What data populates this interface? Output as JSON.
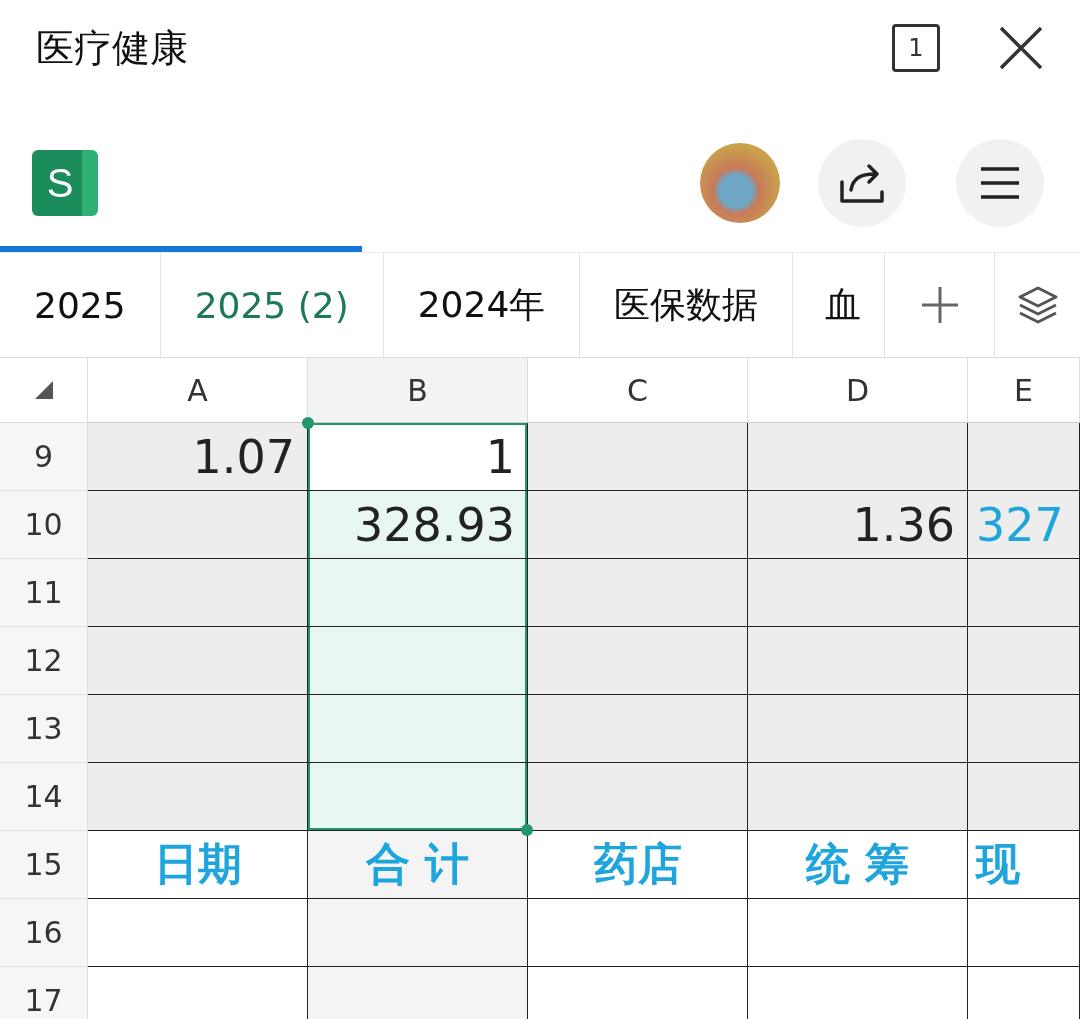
{
  "window": {
    "title": "医疗健康",
    "tab_count": "1"
  },
  "app": {
    "logo_letter": "S"
  },
  "loading_bar": {
    "level": 0.335
  },
  "sheet_tabs": [
    {
      "label": "2025",
      "selected": false
    },
    {
      "label": "2025 (2)",
      "selected": true
    },
    {
      "label": "2024年",
      "selected": false
    },
    {
      "label": "医保数据",
      "selected": false
    },
    {
      "label": "血",
      "selected": false
    }
  ],
  "grid": {
    "columns": [
      {
        "label": "A",
        "selected": false
      },
      {
        "label": "B",
        "selected": true
      },
      {
        "label": "C",
        "selected": false
      },
      {
        "label": "D",
        "selected": false
      },
      {
        "label": "E",
        "selected": false
      }
    ],
    "rows": [
      {
        "number": "9",
        "shaded": true,
        "cells": [
          {
            "text": "1.07",
            "selected": false,
            "active": false
          },
          {
            "text": "1",
            "selected": true,
            "active": true
          },
          {
            "selected": false,
            "active": false
          },
          {
            "selected": false,
            "active": false
          },
          {
            "selected": false,
            "active": false
          }
        ]
      },
      {
        "number": "10",
        "shaded": true,
        "cells": [
          {
            "selected": false,
            "active": false
          },
          {
            "text": "328.93",
            "selected": true,
            "active": false
          },
          {
            "selected": false,
            "active": false
          },
          {
            "text": "1.36",
            "selected": false,
            "active": false
          },
          {
            "text": "327",
            "color": "#1ea5dd",
            "selected": false,
            "active": false
          }
        ]
      },
      {
        "number": "11",
        "shaded": true,
        "cells": [
          {
            "selected": false,
            "active": false
          },
          {
            "selected": true,
            "active": false
          },
          {
            "selected": false,
            "active": false
          },
          {
            "selected": false,
            "active": false
          },
          {
            "selected": false,
            "active": false
          }
        ]
      },
      {
        "number": "12",
        "shaded": true,
        "cells": [
          {
            "selected": false,
            "active": false
          },
          {
            "selected": true,
            "active": false
          },
          {
            "selected": false,
            "active": false
          },
          {
            "selected": false,
            "active": false
          },
          {
            "selected": false,
            "active": false
          }
        ]
      },
      {
        "number": "13",
        "shaded": true,
        "cells": [
          {
            "selected": false,
            "active": false
          },
          {
            "selected": true,
            "active": false
          },
          {
            "selected": false,
            "active": false
          },
          {
            "selected": false,
            "active": false
          },
          {
            "selected": false,
            "active": false
          }
        ]
      },
      {
        "number": "14",
        "shaded": true,
        "cells": [
          {
            "selected": false,
            "active": false
          },
          {
            "selected": true,
            "active": false
          },
          {
            "selected": false,
            "active": false
          },
          {
            "selected": false,
            "active": false
          },
          {
            "selected": false,
            "active": false
          }
        ]
      },
      {
        "number": "15",
        "shaded": false,
        "cells": [
          {
            "text": "日期",
            "color": "#1ea5dd",
            "selected": false,
            "active": false
          },
          {
            "text": "合 计",
            "color": "#1ea5dd",
            "selected": false,
            "active": false
          },
          {
            "text": "药店",
            "color": "#1ea5dd",
            "selected": false,
            "active": false
          },
          {
            "text": "统 筹",
            "color": "#1ea5dd",
            "selected": false,
            "active": false
          },
          {
            "text": "现",
            "color": "#1ea5dd",
            "selected": false,
            "active": false
          }
        ]
      },
      {
        "number": "16",
        "shaded": false,
        "cells": [
          {
            "selected": false,
            "active": false
          },
          {
            "selected": false,
            "active": false
          },
          {
            "selected": false,
            "active": false
          },
          {
            "selected": false,
            "active": false
          },
          {
            "selected": false,
            "active": false
          }
        ]
      },
      {
        "number": "17",
        "shaded": false,
        "cells": [
          {
            "selected": false,
            "active": false
          },
          {
            "selected": false,
            "active": false
          },
          {
            "selected": false,
            "active": false
          },
          {
            "selected": false,
            "active": false
          },
          {
            "selected": false,
            "active": false
          }
        ]
      }
    ]
  }
}
